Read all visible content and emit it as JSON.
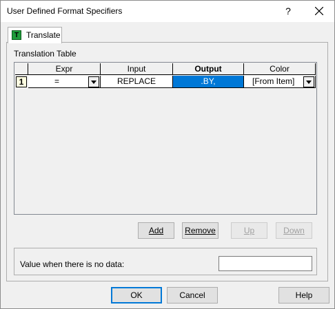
{
  "window": {
    "title": "User Defined Format Specifiers",
    "help_glyph": "?"
  },
  "tab": {
    "label": "Translate",
    "icon_letter": "T",
    "icon_name": "translate-icon"
  },
  "group": {
    "label": "Translation Table"
  },
  "grid": {
    "columns": [
      "Expr",
      "Input",
      "Output",
      "Color"
    ],
    "active_column": "Output",
    "rows": [
      {
        "num": "1",
        "expr": "=",
        "input": "REPLACE",
        "output": ".BY,",
        "color": "[From Item]"
      }
    ]
  },
  "grid_buttons": {
    "add": "Add",
    "remove": "Remove",
    "up": "Up",
    "down": "Down"
  },
  "nodata": {
    "label": "Value when there is no data:",
    "value": ""
  },
  "footer": {
    "ok": "OK",
    "cancel": "Cancel",
    "help": "Help"
  },
  "colors": {
    "selection": "#0078d7",
    "tab_icon": "#1f9b3a"
  }
}
